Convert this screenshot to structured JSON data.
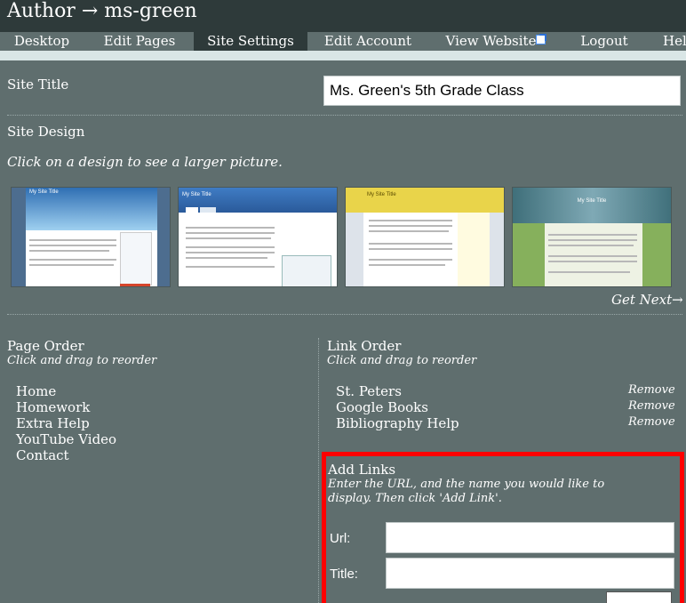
{
  "header": {
    "title": "Author → ms-green"
  },
  "nav": {
    "tabs": [
      {
        "label": "Desktop"
      },
      {
        "label": "Edit Pages"
      },
      {
        "label": "Site Settings"
      },
      {
        "label": "Edit Account"
      },
      {
        "label": "View Website"
      },
      {
        "label": "Logout"
      },
      {
        "label": "Help"
      }
    ],
    "active": "Site Settings",
    "external_icon": "external-link-icon"
  },
  "site_title": {
    "label": "Site Title",
    "value": "Ms. Green's 5th Grade Class"
  },
  "site_design": {
    "label": "Site Design",
    "hint": "Click on a design to see a larger picture.",
    "thumb_titles": [
      "My Site Title",
      "My Site Title",
      "My Site Title",
      "My Site Title"
    ],
    "get_next": "Get Next→"
  },
  "page_order": {
    "title": "Page Order",
    "hint": "Click and drag to reorder",
    "items": [
      "Home",
      "Homework",
      "Extra Help",
      "YouTube Video",
      "Contact"
    ]
  },
  "link_order": {
    "title": "Link Order",
    "hint": "Click and drag to reorder",
    "items": [
      {
        "label": "St. Peters",
        "remove": "Remove"
      },
      {
        "label": "Google Books",
        "remove": "Remove"
      },
      {
        "label": "Bibliography Help",
        "remove": "Remove"
      }
    ]
  },
  "add_links": {
    "title": "Add Links",
    "hint_line1": "Enter the URL, and the name you would like to",
    "hint_line2": "display. Then click 'Add Link'.",
    "url_label": "Url:",
    "title_label": "Title:",
    "url_value": "",
    "title_value": ""
  },
  "colors": {
    "background": "#5f6e6e",
    "header": "#2e3a3a",
    "band": "#d9e6e6",
    "highlight": "#ff0000"
  }
}
